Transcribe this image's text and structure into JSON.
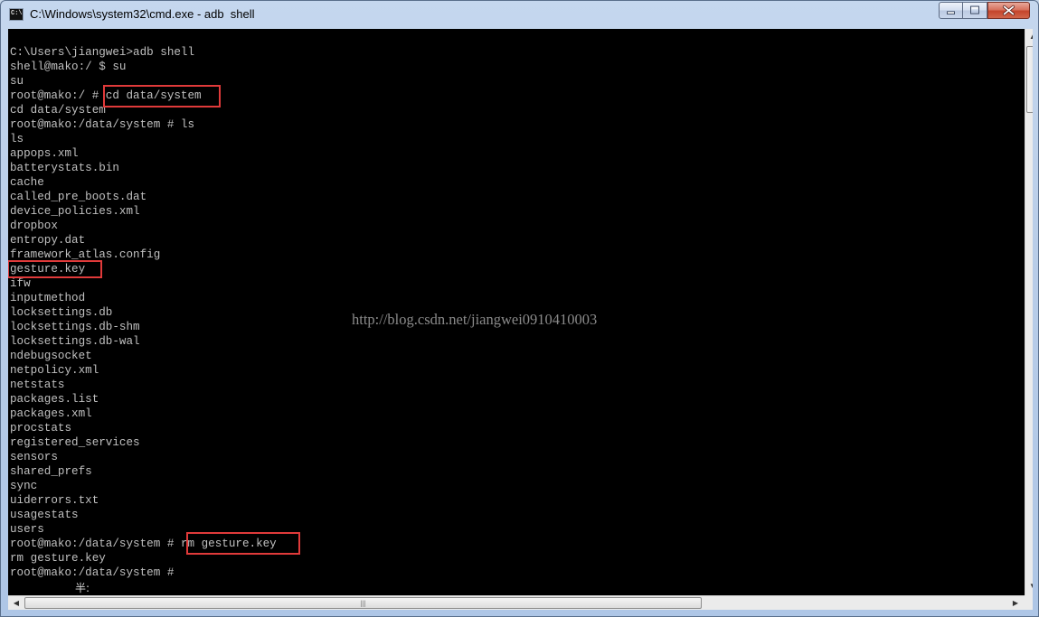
{
  "window": {
    "title": "C:\\Windows\\system32\\cmd.exe - adb  shell",
    "icon": "cmd-icon"
  },
  "controls": {
    "minimize": "minimize-icon",
    "maximize": "maximize-icon",
    "close": "close-icon"
  },
  "console": {
    "lines": [
      "C:\\Users\\jiangwei>adb shell",
      "shell@mako:/ $ su",
      "su",
      "root@mako:/ # cd data/system",
      "cd data/system",
      "root@mako:/data/system # ls",
      "ls",
      "appops.xml",
      "batterystats.bin",
      "cache",
      "called_pre_boots.dat",
      "device_policies.xml",
      "dropbox",
      "entropy.dat",
      "framework_atlas.config",
      "gesture.key",
      "ifw",
      "inputmethod",
      "locksettings.db",
      "locksettings.db-shm",
      "locksettings.db-wal",
      "ndebugsocket",
      "netpolicy.xml",
      "netstats",
      "packages.list",
      "packages.xml",
      "procstats",
      "registered_services",
      "sensors",
      "shared_prefs",
      "sync",
      "uiderrors.txt",
      "usagestats",
      "users",
      "root@mako:/data/system # rm gesture.key",
      "rm gesture.key",
      "root@mako:/data/system #"
    ],
    "ime_indicator": "半:",
    "watermark": "http://blog.csdn.net/jiangwei0910410003",
    "highlight_color": "#e03a3a"
  },
  "scrollbars": {
    "up_arrow": "▲",
    "down_arrow": "▼",
    "left_arrow": "◀",
    "right_arrow": "▶",
    "grip": "|||"
  }
}
